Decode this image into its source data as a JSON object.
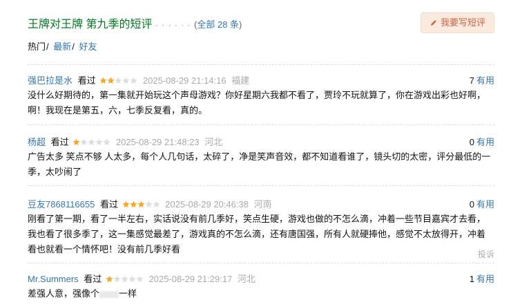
{
  "header": {
    "title": "王牌对王牌 第九季的短评",
    "dots": "· · · · · ·",
    "open_paren": "(",
    "all_label": "全部 28 条",
    "close_paren": ")",
    "write_button": "我要写短评"
  },
  "tabs": {
    "hot": "热门",
    "latest": "最新",
    "friends": "好友",
    "separator": "/"
  },
  "comments": [
    {
      "user": "强巴拉是水",
      "status": "看过",
      "rating": 2,
      "date": "2025-08-29 21:14:16",
      "location": "福建",
      "votes": "7",
      "useful_label": "有用",
      "lines": [
        "没什么好期待的，第一集就开始玩这个声母游戏？你好星期六我都不看了，贾玲不玩就算了，你在游戏出彩也好啊，",
        "啊！我现在是第五，六，七季反复看，真的。"
      ]
    },
    {
      "user": "杨超",
      "status": "看过",
      "rating": 1,
      "date": "2025-08-29 21:48:23",
      "location": "河北",
      "votes": "0",
      "useful_label": "有用",
      "lines": [
        "广告太多 笑点不够 人太多，每个人几句话，太碎了，净是笑声音效，都不知道看谁了，镜头切的太密，评分最低的一",
        "季，太吵闹了"
      ]
    },
    {
      "user": "豆友7868116655",
      "status": "看过",
      "rating": 3,
      "date": "2025-08-29 20:46:38",
      "location": "河南",
      "votes": "0",
      "useful_label": "有用",
      "lines": [
        "刚看了第一期，看了一半左右，实话说没有前几季好，笑点生硬，游戏也做的不怎么滴，冲着一些节目嘉宾才去看，",
        "我也看了很多季了，这一集感觉最差了，游戏真的不怎么滴，还有唐国强，所有人就硬捧他，感觉不太放得开，冲着",
        "看也就看一个情怀吧！没有前几季好看"
      ],
      "report": "投诉"
    },
    {
      "user": "Mr.Summers",
      "status": "看过",
      "rating": 1,
      "date": "2025-08-29 21:29:17",
      "location": "河北",
      "votes": "1",
      "useful_label": "有用",
      "text_before": "差强人意，强像个",
      "text_after": "一样"
    }
  ]
}
